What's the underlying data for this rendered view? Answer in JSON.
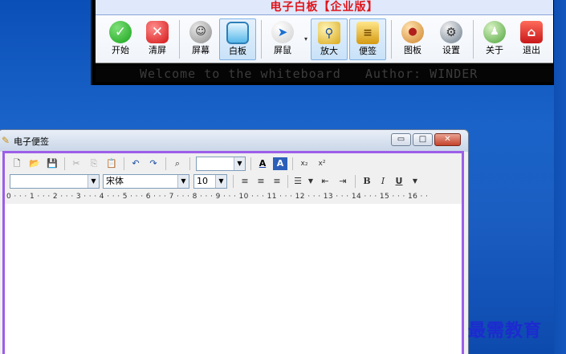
{
  "whiteboard": {
    "title": "电子白板【企业版】",
    "buttons": [
      {
        "label": "开始",
        "icon": "start-icon",
        "glyph": "✓"
      },
      {
        "label": "清屏",
        "icon": "clear-screen-icon",
        "glyph": "✕"
      },
      {
        "label": "屏幕",
        "icon": "screen-icon",
        "glyph": "☺"
      },
      {
        "label": "白板",
        "icon": "whiteboard-icon",
        "glyph": ""
      },
      {
        "label": "屏鼠",
        "icon": "screen-mouse-icon",
        "glyph": "➤"
      },
      {
        "label": "放大",
        "icon": "magnifier-icon",
        "glyph": "⚲"
      },
      {
        "label": "便签",
        "icon": "notepad-icon",
        "glyph": "≡"
      },
      {
        "label": "图板",
        "icon": "palette-icon",
        "glyph": "●"
      },
      {
        "label": "设置",
        "icon": "settings-icon",
        "glyph": "⚙"
      },
      {
        "label": "关于",
        "icon": "about-icon",
        "glyph": "♟"
      },
      {
        "label": "退出",
        "icon": "exit-icon",
        "glyph": "⌂"
      }
    ],
    "marquee": "Welcome to the whiteboard   Author: WINDER"
  },
  "note_window": {
    "title": "电子便签",
    "font_name": "宋体",
    "font_size": "10",
    "style_value": "",
    "color_value": "",
    "ruler": "0 · · · 1 · · · 2 · · · 3 · · · 4 · · · 5 · · · 6 · · · 7 · · · 8 · · · 9 · · · 10 · · · 11 · · · 12 · · · 13 · · · 14 · · · 15 · · · 16 · ·",
    "format_buttons": {
      "bold": "B",
      "italic": "I",
      "underline": "U"
    },
    "caption_buttons": {
      "minimize": "▭",
      "maximize": "□",
      "close": "✕"
    }
  },
  "watermark": "最需教育",
  "colors": {
    "title_red": "#e0141a",
    "note_border": "#9c5fe8",
    "watermark_blue": "#1d2ad0"
  }
}
